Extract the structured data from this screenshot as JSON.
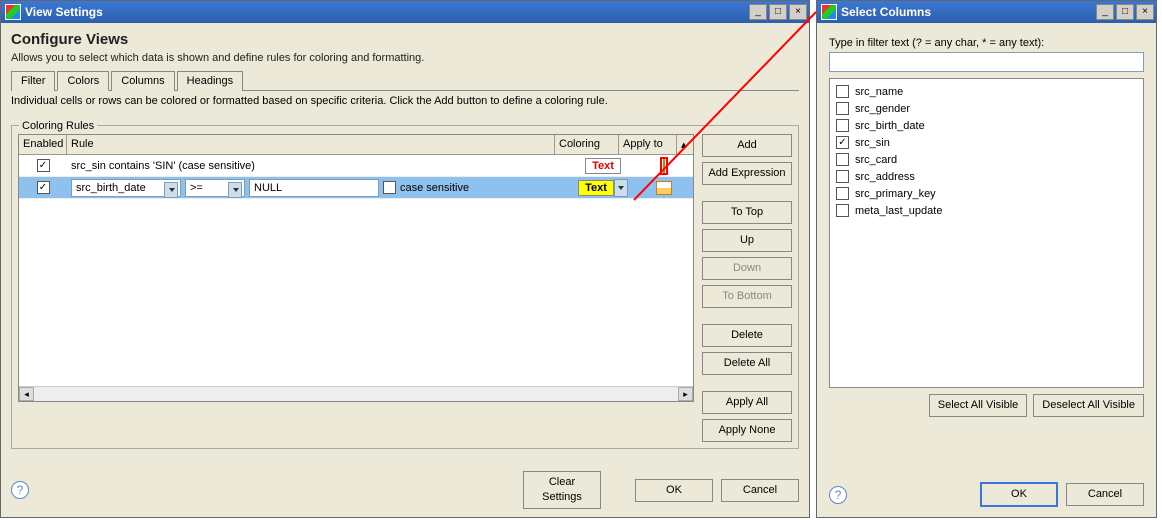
{
  "viewSettings": {
    "title": "View Settings",
    "heading": "Configure Views",
    "description": "Allows you to select which data is shown and define rules for coloring and formatting.",
    "tabs": [
      "Filter",
      "Colors",
      "Columns",
      "Headings"
    ],
    "activeTab": "Colors",
    "colorsDesc": "Individual cells or rows can be colored or formatted based on specific criteria. Click the Add button to define a coloring rule.",
    "fieldsetLabel": "Coloring Rules",
    "gridHeaders": {
      "enabled": "Enabled",
      "rule": "Rule",
      "coloring": "Coloring",
      "applyTo": "Apply to"
    },
    "rows": [
      {
        "enabled": true,
        "ruleText": "src_sin contains 'SIN' (case sensitive)",
        "coloringSample": "Text",
        "coloringStyle": "red",
        "applyHighlighted": true
      },
      {
        "enabled": true,
        "selected": true,
        "fieldDropdown": "src_birth_date",
        "opDropdown": ">=",
        "valueInput": "NULL",
        "caseSensitiveLabel": "case sensitive",
        "caseSensitiveChecked": false,
        "coloringSample": "Text",
        "coloringStyle": "yel"
      }
    ],
    "sideButtons": {
      "add": "Add",
      "addExpression": "Add Expression",
      "toTop": "To Top",
      "up": "Up",
      "down": "Down",
      "toBottom": "To Bottom",
      "delete": "Delete",
      "deleteAll": "Delete All",
      "applyAll": "Apply All",
      "applyNone": "Apply None"
    },
    "footer": {
      "clearSettings": "Clear Settings",
      "ok": "OK",
      "cancel": "Cancel"
    }
  },
  "selectColumns": {
    "title": "Select Columns",
    "filterLabel": "Type in filter text (? = any char, * = any text):",
    "filterValue": "",
    "items": [
      {
        "label": "src_name",
        "checked": false
      },
      {
        "label": "src_gender",
        "checked": false
      },
      {
        "label": "src_birth_date",
        "checked": false
      },
      {
        "label": "src_sin",
        "checked": true
      },
      {
        "label": "src_card",
        "checked": false
      },
      {
        "label": "src_address",
        "checked": false
      },
      {
        "label": "src_primary_key",
        "checked": false
      },
      {
        "label": "meta_last_update",
        "checked": false
      }
    ],
    "selectAll": "Select All Visible",
    "deselectAll": "Deselect All Visible",
    "ok": "OK",
    "cancel": "Cancel"
  }
}
